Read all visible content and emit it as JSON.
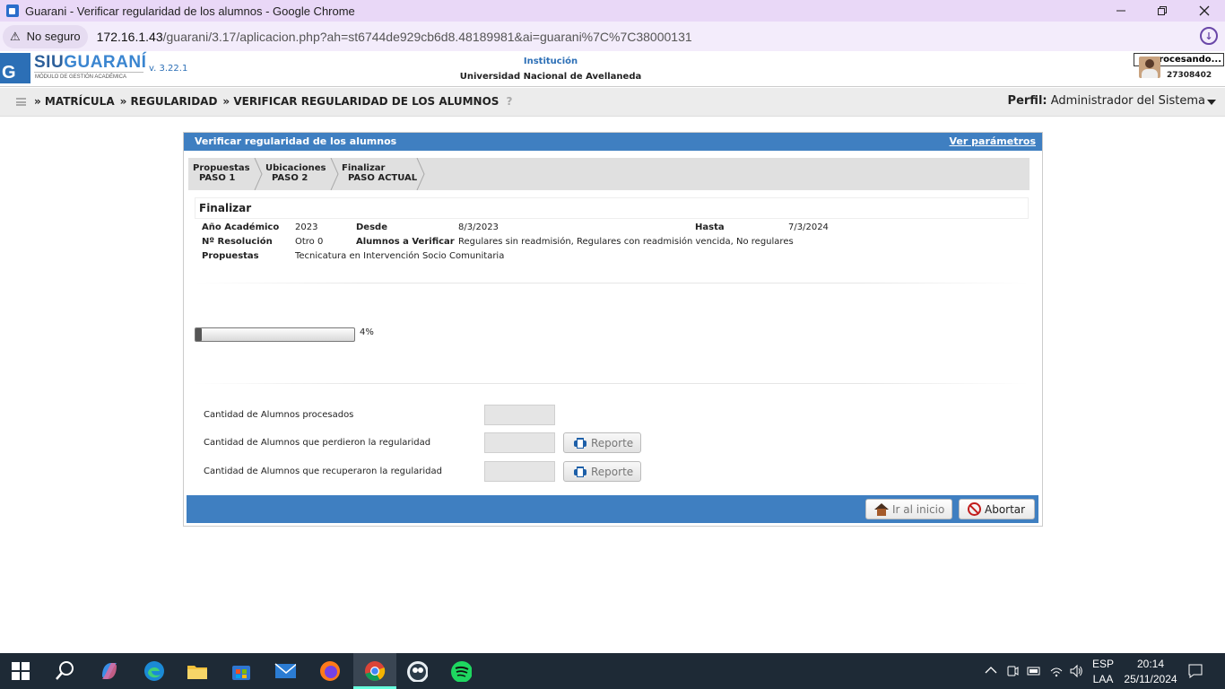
{
  "browser": {
    "tab_title": "Guarani - Verificar regularidad de los alumnos - Google Chrome",
    "security_label": "No seguro",
    "url_host": "172.16.1.43",
    "url_path": "/guarani/3.17/aplicacion.php?ah=st6744de929cb6d8.48189981&ai=guarani%7C%7C38000131"
  },
  "header": {
    "logo_siu": "SIU",
    "logo_guarani": "GUARANÍ",
    "logo_g": "G",
    "logo_subtitle": "MÓDULO DE GESTIÓN ACADÉMICA",
    "version": "v. 3.22.1",
    "institution_label": "Institución",
    "institution_name": "Universidad Nacional de Avellaneda",
    "user_status": "rocesando...",
    "user_id": "27308402"
  },
  "navbar": {
    "crumbs": [
      "» MATRÍCULA",
      "» REGULARIDAD",
      "» VERIFICAR REGULARIDAD DE LOS ALUMNOS"
    ],
    "help": "?",
    "profile_label": "Perfil:",
    "profile_value": "Administrador del Sistema"
  },
  "panel": {
    "title": "Verificar regularidad de los alumnos",
    "params_link": "Ver parámetros",
    "steps": [
      {
        "name": "Propuestas",
        "sub": "PASO 1"
      },
      {
        "name": "Ubicaciones",
        "sub": "PASO 2"
      },
      {
        "name": "Finalizar",
        "sub": "PASO ACTUAL"
      }
    ],
    "section_title": "Finalizar",
    "info": {
      "anio_label": "Año Académico",
      "anio_value": "2023",
      "desde_label": "Desde",
      "desde_value": "8/3/2023",
      "hasta_label": "Hasta",
      "hasta_value": "7/3/2024",
      "resolucion_label": "Nº Resolución",
      "resolucion_value": "Otro 0",
      "alumnos_label": "Alumnos a Verificar",
      "alumnos_value": "Regulares sin readmisión, Regulares con readmisión vencida, No regulares",
      "propuestas_label": "Propuestas",
      "propuestas_value": "Tecnicatura en Intervención Socio Comunitaria"
    },
    "progress": {
      "percent": 4,
      "label": "4%"
    },
    "rows": [
      {
        "label": "Cantidad de Alumnos procesados",
        "value": ""
      },
      {
        "label": "Cantidad de Alumnos que perdieron la regularidad",
        "value": "",
        "button": "Reporte"
      },
      {
        "label": "Cantidad de Alumnos que recuperaron la regularidad",
        "value": "",
        "button": "Reporte"
      }
    ],
    "btn_home": "Ir al inicio",
    "btn_abort": "Abortar"
  },
  "taskbar": {
    "lang_top": "ESP",
    "lang_bottom": "LAA",
    "time": "20:14",
    "date": "25/11/2024"
  },
  "colors": {
    "accent": "#3f7fc1",
    "brand": "#2c6fb6",
    "titlebar": "#e9d8f7"
  }
}
